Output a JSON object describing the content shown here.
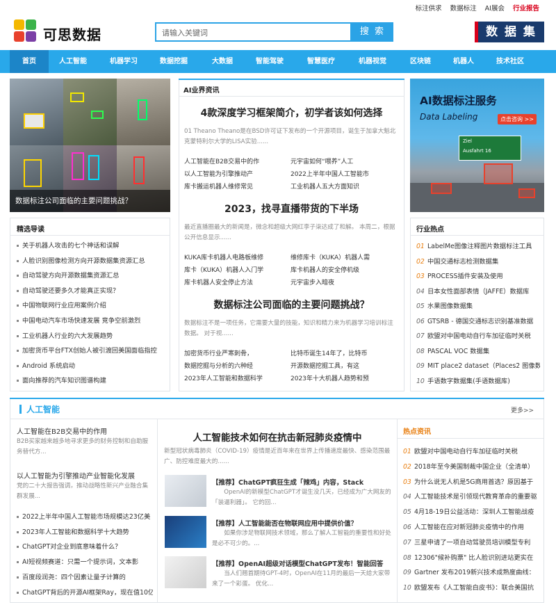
{
  "top_links": [
    "标注供求",
    "数据标注",
    "AI展会",
    "行业报告"
  ],
  "logo": {
    "text": "可思数据"
  },
  "search": {
    "placeholder": "请输入关键词",
    "button": "搜 索"
  },
  "banner": {
    "label": "数 据 集"
  },
  "nav": [
    "首页",
    "人工智能",
    "机器学习",
    "数据挖掘",
    "大数据",
    "智能驾驶",
    "智慧医疗",
    "机器视觉",
    "区块链",
    "机器人",
    "技术社区"
  ],
  "hero": {
    "caption": "数据标注公司面临的主要问题挑战？"
  },
  "selected": {
    "title": "精选导读",
    "items": [
      "关于机器人攻击的七个神话和误解",
      "人脸识别图像检测方向开源数据集资源汇总",
      "自动驾驶方向开源数据集资源汇总",
      "自动驾驶还要多久才能真正实现？",
      "中国物联网行业应用案例介绍",
      "中国电动汽车市场快速发展 竞争空前激烈",
      "工业机器人行业的六大发展趋势",
      "加密货币平台FTX创始人被引渡回美国面临指控",
      "Android 系统启动",
      "面向推荐的汽车知识图谱构建"
    ]
  },
  "news": {
    "title": "AI业界资讯",
    "blocks": [
      {
        "headline": "4款深度学习框架简介，初学者该如何选择",
        "desc": "01 Theano Theano是在BSD许可证下发布的一个开源项目，诞生于加拿大魁北克蒙特利尔大学的LISA实验......",
        "links": [
          "人工智能在B2B交易中的作",
          "元宇宙如何“喂养”人工",
          "以人工智能为引擎推动产",
          "2022上半年中国人工智能市",
          "库卡搬运机器人维修常见",
          "工业机器人五大方面知识"
        ]
      },
      {
        "headline": "2023，找寻直播带货的下半场",
        "desc": "最近直播圈最大的新闻是，微念和超级大网红李子柒达成了和解。 本周二，根据公开信息显示......",
        "links": [
          "KUKA库卡机器人电路板维修",
          "维修库卡（KUKA）机器人需",
          "库卡（KUKA）机器人入门学",
          "库卡机器人的安全停机级",
          "库卡机器人安全停止方法",
          "元宇宙步入暗夜"
        ]
      },
      {
        "headline": "数据标注公司面临的主要问题挑战？",
        "desc": "数据标注不是一项任务，它需要大量的技能，知识和精力来为机器学习培训标注数据。 对于视......",
        "links": [
          "加密货币行业严寒刺骨，",
          "比特币诞生14年了，比特币",
          "数据挖掘与分析的六种经",
          "开源数据挖掘工具，有这",
          "2023年人工智能和数据科学",
          "2023年十大机器人趋势和预"
        ]
      }
    ]
  },
  "ad": {
    "title": "AI数据标注服务",
    "subtitle": "Data Labeling",
    "cta": "点击咨询 >>",
    "sign_top": "Ziel",
    "sign_bottom": "Ausfahrt 16"
  },
  "hot": {
    "title": "行业热点",
    "items": [
      "LabelMe图像注释图片数据标注工具",
      "中国交通标志检测数据集",
      "PROCESS插件安装及使用",
      "日本女性面部表情（JAFFE）数据库",
      "水果图像数据集",
      "GTSRB - 德国交通标志识别基准数据",
      "欧盟对中国电动自行车加征临时关税",
      "PASCAL VOC 数据集",
      "MIT place2 dataset（Places2 图像数",
      "手语数字数据集(手语数据库)"
    ]
  },
  "ai_section": {
    "title": "人工智能",
    "more": "更多>>",
    "left_features": [
      {
        "title": "人工智能在B2B交易中的作用",
        "desc": "B2B买家越来越多地寻求更多的财务控制和自助服务替代方..."
      },
      {
        "title": "以人工智能为引擎推动产业智能化发展",
        "desc": "党的二十大报告强调，推动战略性新兴产业融合集群发展..."
      }
    ],
    "left_list": [
      "2022上半年中国人工智能市场规模达23亿美",
      "2023年人工智能和数据科学十大趋势",
      "ChatGPT对企业到底意味着什么？",
      "AI短视频赛道：只需一个提示词，文本影",
      "百度段润尧：四个因素让量子计算的",
      "ChatGPT背后的开源AI框架Ray，现在值10亿"
    ],
    "main": {
      "headline": "人工智能技术如何在抗击新冠肺炎疫情中",
      "desc": "新型冠状病毒肺炎（COVID-19）疫情是近百年来在世界上传播速度最快、感染范围最广、防控难度最大的......",
      "stories": [
        {
          "title": "【推荐】ChatGPT疯狂生成「辣鸡」内容，Stack",
          "desc": "OpenAI的新模型ChatGPT才诞生没几天，已经成为广大网友的「装逼利器」。 它的回..."
        },
        {
          "title": "【推荐】人工智能能否在物联网应用中提供价值？",
          "desc": "如果你涉足物联网技术领域，那么了解人工智能的重要性和好处是必不可少的。..."
        },
        {
          "title": "【推荐】OpenAI超级对话模型ChatGPT发布！智能回答",
          "desc": "当人们翘首期待GPT-4时，OpenAI在11月的最后一天给大家带来了一个彩蛋。 优化..."
        }
      ]
    },
    "hot_title": "热点资讯",
    "hot_items": [
      "欧盟对中国电动自行车加征临时关税",
      "2018年至今美国制裁中国企业（全清单）",
      "为什么说无人机是5G商用首选？原因基于",
      "人工智能技术是引领现代教育革命的重要驱",
      "4月18-19日公益活动：深圳人工智能战疫",
      "人工智能在应对新冠肺炎疫情中的作用",
      "三星申请了一项自动驾驶员培训模型专利",
      "12306\"候补购票\" 比人脸识别进站更实在",
      "Gartner 发布2019新兴技术成熟度曲线：",
      "欧盟发布《人工智能白皮书》：联合美国抗"
    ]
  }
}
